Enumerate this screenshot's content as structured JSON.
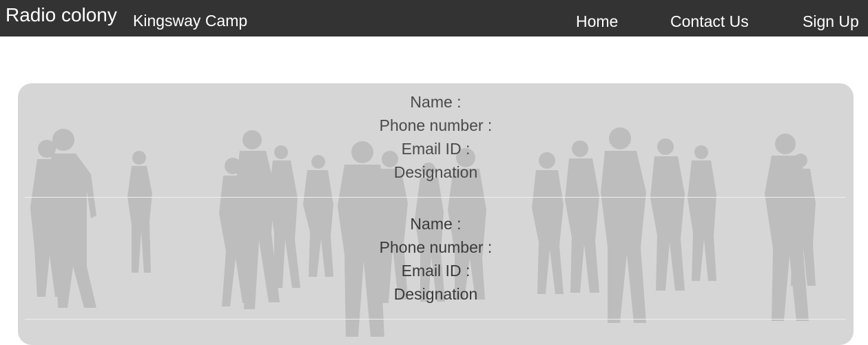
{
  "navbar": {
    "brand": "Radio colony",
    "subtitle": "Kingsway Camp",
    "links": [
      "Home",
      "Contact Us",
      "Sign Up"
    ]
  },
  "members": [
    {
      "name_label": "Name :",
      "phone_label": "Phone number :",
      "email_label": "Email ID :",
      "designation_label": "Designation"
    },
    {
      "name_label": "Name :",
      "phone_label": "Phone number :",
      "email_label": "Email ID :",
      "designation_label": "Designation"
    }
  ],
  "colors": {
    "navbar_bg": "#333333",
    "panel_bg": "#d6d6d6",
    "silhouette": "#bdbdbd"
  }
}
